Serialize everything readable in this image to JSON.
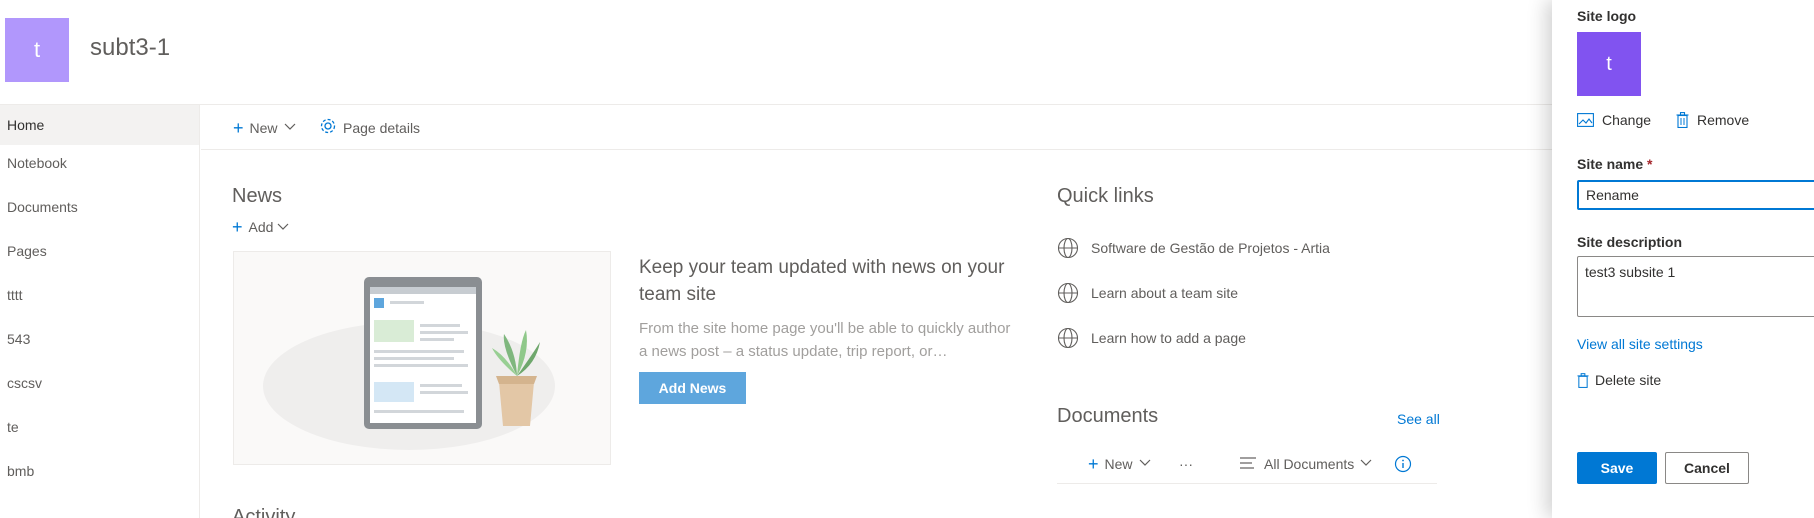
{
  "colors": {
    "accent": "#0078d4",
    "site_logo_bg": "#b197fc",
    "panel_logo_bg": "#8153f0",
    "add_news_bg": "#5ea6dd"
  },
  "site": {
    "logo_letter": "t",
    "title": "subt3-1"
  },
  "nav": {
    "items": [
      {
        "label": "Home",
        "active": true
      },
      {
        "label": "Notebook"
      },
      {
        "label": "Documents"
      },
      {
        "label": "Pages"
      },
      {
        "label": "tttt"
      },
      {
        "label": "543"
      },
      {
        "label": "cscsv"
      },
      {
        "label": "te"
      },
      {
        "label": "bmb"
      }
    ]
  },
  "command_bar": {
    "new_label": "New",
    "page_details_label": "Page details",
    "new_icon": "plus-icon",
    "page_details_icon": "gear-icon"
  },
  "news": {
    "title": "News",
    "add_label": "Add",
    "headline": "Keep your team updated with news on your team site",
    "body": "From the site home page you'll be able to quickly author a news post – a status update, trip report, or…",
    "add_news_button": "Add News"
  },
  "activity": {
    "title": "Activity"
  },
  "quick_links": {
    "title": "Quick links",
    "items": [
      {
        "label": "Software de Gestão de Projetos - Artia",
        "icon": "globe-icon"
      },
      {
        "label": "Learn about a team site",
        "icon": "globe-icon"
      },
      {
        "label": "Learn how to add a page",
        "icon": "globe-icon"
      }
    ]
  },
  "documents": {
    "title": "Documents",
    "see_all": "See all",
    "new_label": "New",
    "more_label": "···",
    "view_label": "All Documents"
  },
  "panel": {
    "site_logo_label": "Site logo",
    "logo_letter": "t",
    "change_label": "Change",
    "remove_label": "Remove",
    "site_name_label": "Site name",
    "required_mark": "*",
    "site_name_value": "Rename",
    "site_description_label": "Site description",
    "site_description_value": "test3 subsite 1",
    "view_all_settings": "View all site settings",
    "delete_site": "Delete site",
    "save": "Save",
    "cancel": "Cancel"
  }
}
